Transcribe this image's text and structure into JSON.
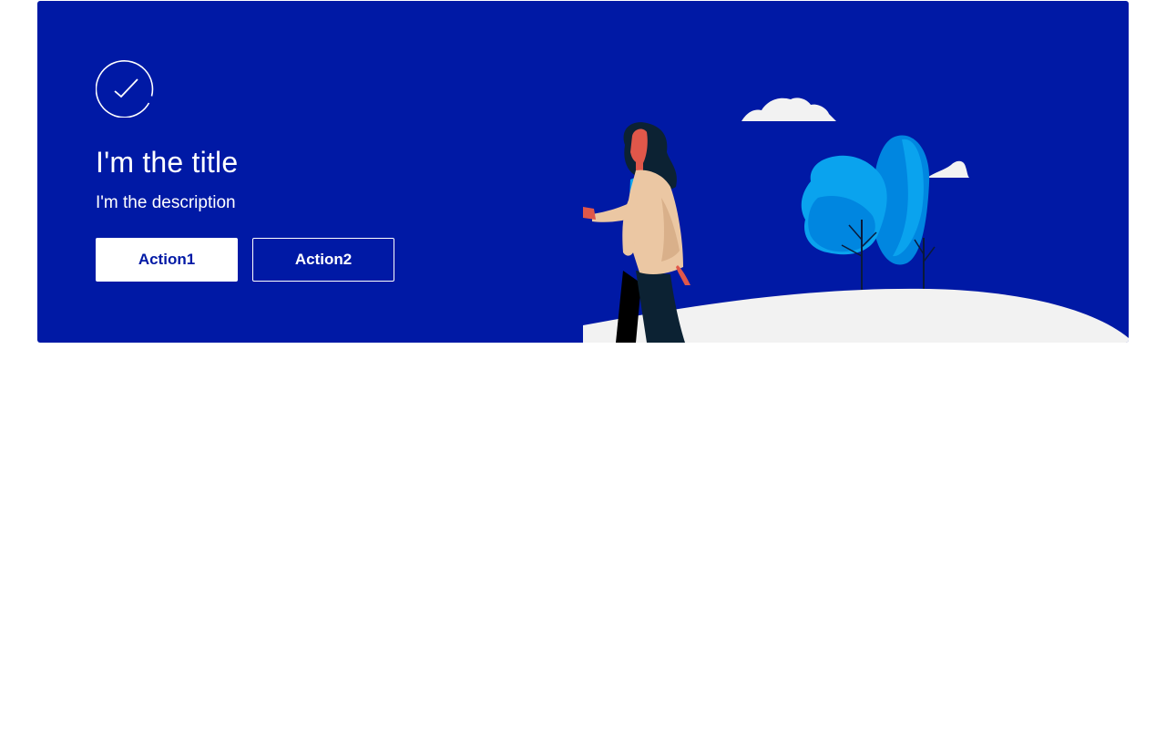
{
  "hero": {
    "icon": "checkmark-circle-icon",
    "title": "I'm the title",
    "description": "I'm the description",
    "primary_action_label": "Action1",
    "secondary_action_label": "Action2",
    "illustration": "woman-walking-by-trees-illustration"
  },
  "colors": {
    "hero_background": "#0019a5",
    "button_primary_bg": "#ffffff",
    "button_primary_text": "#0019a5",
    "ground": "#f2f2f2",
    "tree_light": "#0aa3ee",
    "tree_dark": "#0086e0"
  }
}
